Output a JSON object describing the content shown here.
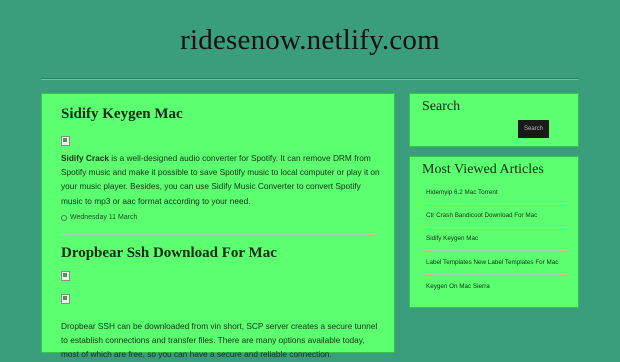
{
  "site": {
    "title": "ridesenow.netlify.com"
  },
  "posts": [
    {
      "title": "Sidify Keygen Mac",
      "excerpt_bold": "Sidify Crack",
      "excerpt_rest": " is a well-designed audio converter for Spotify. It can remove DRM from Spotify music and make it possible to save Spotify music to local computer or play it on your music player. Besides, you can use Sidify Music Converter to convert Spotify music to mp3 or aac format according to your need.",
      "date": "Wednesday 11 March"
    },
    {
      "title": "Dropbear Ssh Download For Mac",
      "excerpt": "Dropbear SSH can be downloaded from vin short, SCP server creates a secure tunnel to establish connections and transfer files. There are many options available today, most of which are free, so you can have a secure and reliable connection."
    }
  ],
  "sidebar": {
    "search": {
      "title": "Search",
      "button_label": "Search"
    },
    "most_viewed": {
      "title": "Most Viewed Articles",
      "items": [
        "Hidemyip 6.2 Mac Torrent",
        "Ctr Crash Bandicoot Download For Mac",
        "Sidify Keygen Mac",
        "Label Templates New Label Templates For Mac",
        "Keygen On Mac Sierra"
      ]
    }
  }
}
